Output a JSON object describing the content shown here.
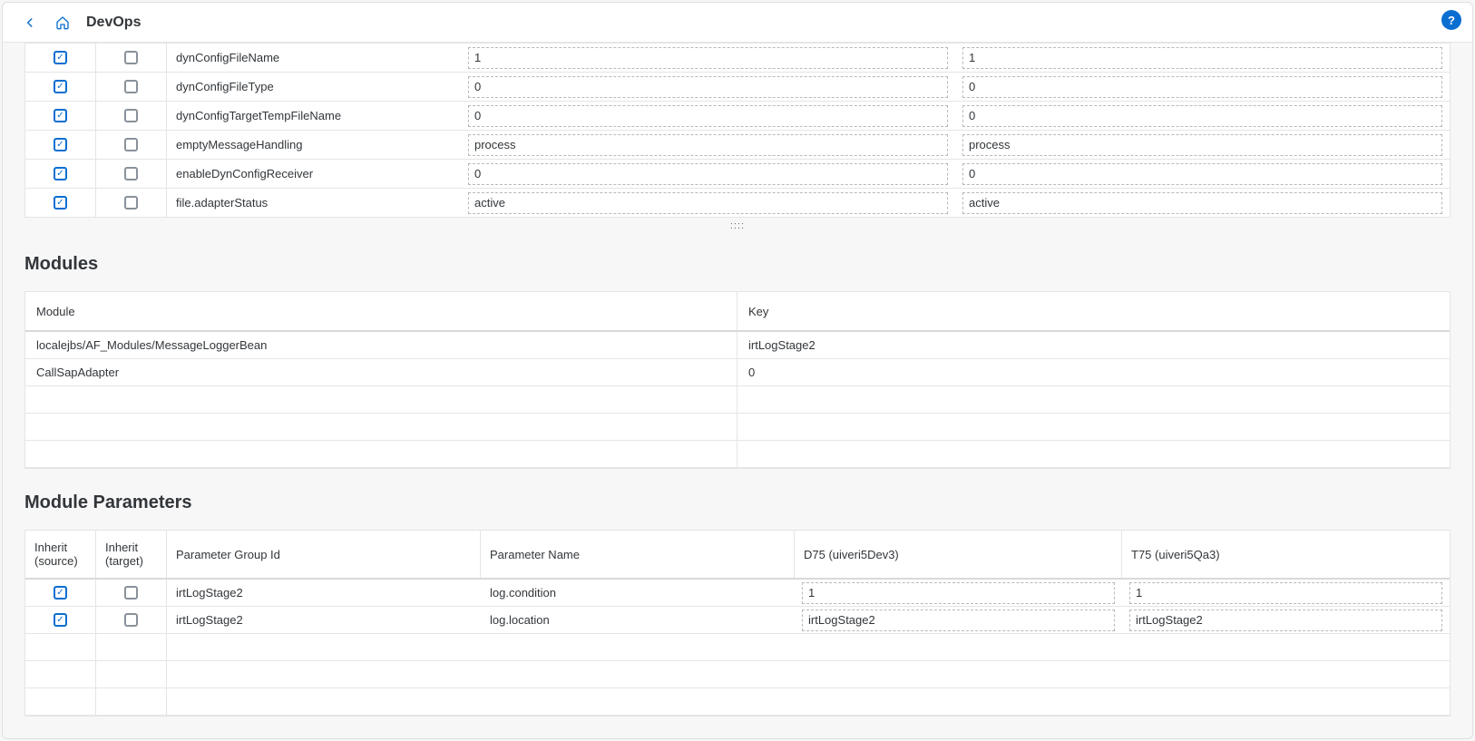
{
  "header": {
    "title": "DevOps"
  },
  "config_rows": [
    {
      "name": "dynConfigFileName",
      "v1": "1",
      "v2": "1"
    },
    {
      "name": "dynConfigFileType",
      "v1": "0",
      "v2": "0"
    },
    {
      "name": "dynConfigTargetTempFileName",
      "v1": "0",
      "v2": "0"
    },
    {
      "name": "emptyMessageHandling",
      "v1": "process",
      "v2": "process"
    },
    {
      "name": "enableDynConfigReceiver",
      "v1": "0",
      "v2": "0"
    },
    {
      "name": "file.adapterStatus",
      "v1": "active",
      "v2": "active"
    }
  ],
  "modules": {
    "title": "Modules",
    "head": {
      "module": "Module",
      "key": "Key"
    },
    "rows": [
      {
        "module": "localejbs/AF_Modules/MessageLoggerBean",
        "key": "irtLogStage2"
      },
      {
        "module": "CallSapAdapter",
        "key": "0"
      },
      {
        "module": "",
        "key": ""
      },
      {
        "module": "",
        "key": ""
      },
      {
        "module": "",
        "key": ""
      }
    ]
  },
  "module_params": {
    "title": "Module Parameters",
    "head": {
      "inherit_source": "Inherit (source)",
      "inherit_target": "Inherit (target)",
      "group": "Parameter Group Id",
      "name": "Parameter Name",
      "d75": "D75 (uiveri5Dev3)",
      "t75": "T75 (uiveri5Qa3)"
    },
    "rows": [
      {
        "group": "irtLogStage2",
        "name": "log.condition",
        "d75": "1",
        "t75": "1"
      },
      {
        "group": "irtLogStage2",
        "name": "log.location",
        "d75": "irtLogStage2",
        "t75": "irtLogStage2"
      },
      {
        "group": "",
        "name": "",
        "d75": "",
        "t75": ""
      },
      {
        "group": "",
        "name": "",
        "d75": "",
        "t75": ""
      },
      {
        "group": "",
        "name": "",
        "d75": "",
        "t75": ""
      }
    ]
  }
}
